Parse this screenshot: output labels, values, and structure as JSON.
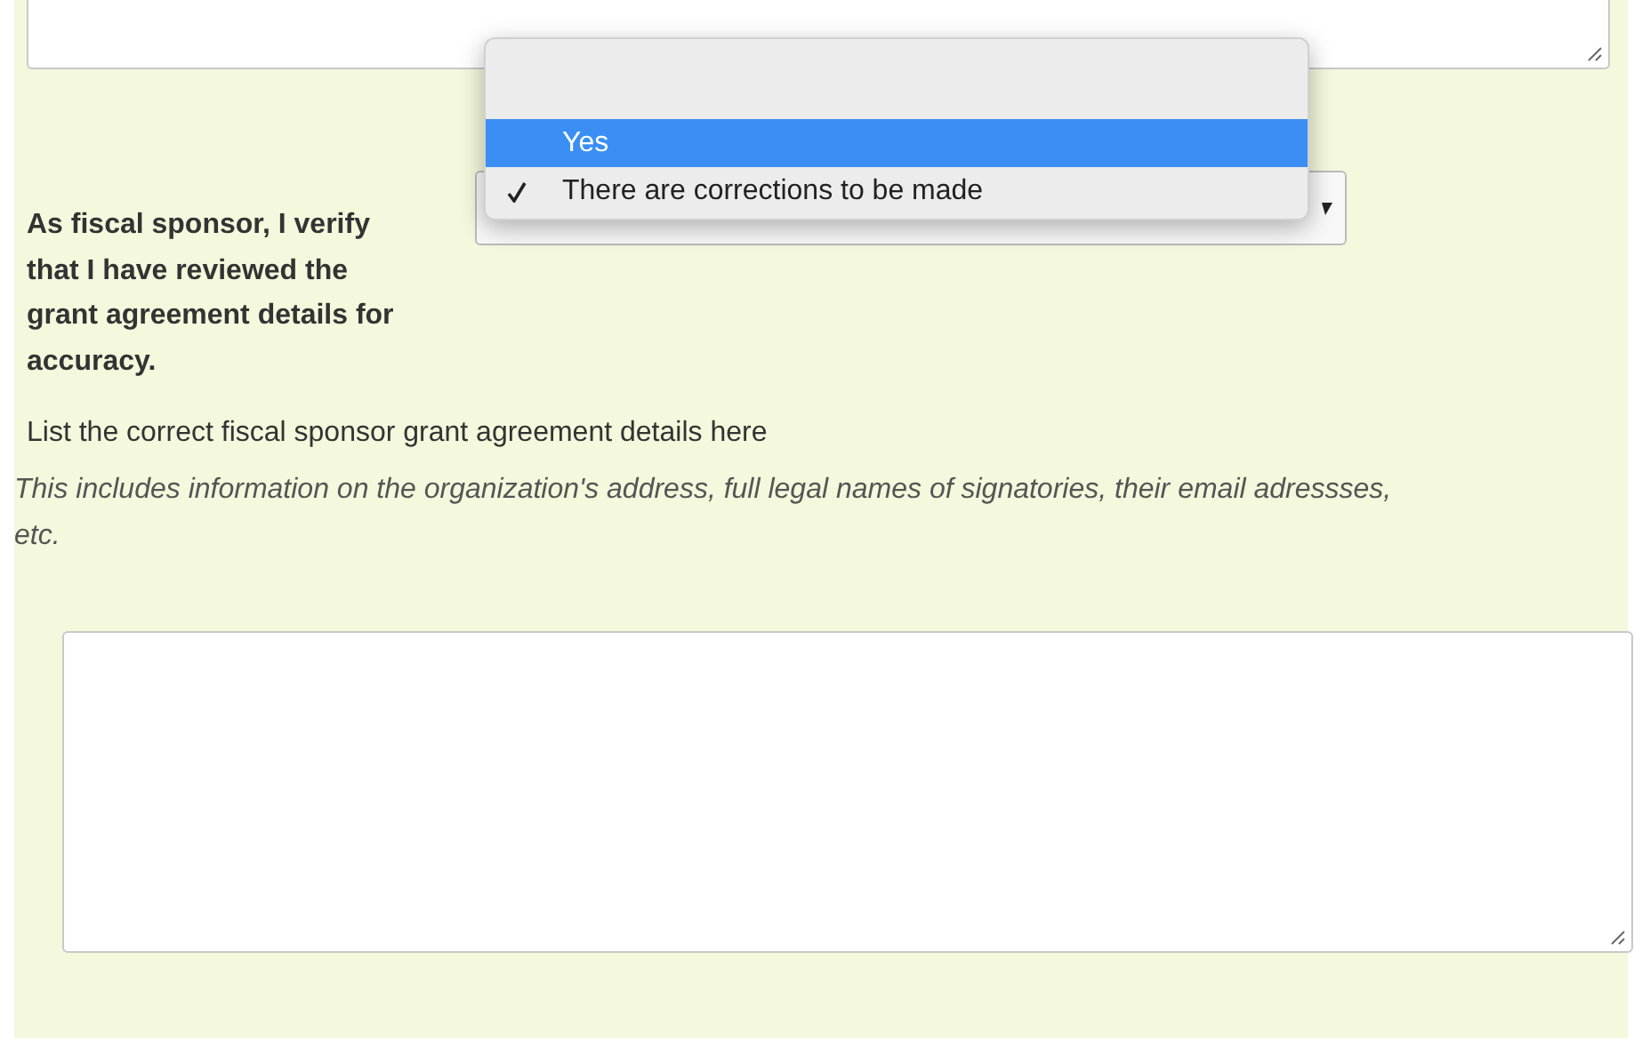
{
  "question": {
    "label": "As fiscal sponsor, I verify that I have reviewed the grant agreement details for accuracy."
  },
  "dropdown_menu": {
    "options": [
      {
        "highlighted": false,
        "checked": false
      },
      {
        "label": "Yes",
        "highlighted": true,
        "checked": false
      },
      {
        "label": "There are corrections to be made",
        "highlighted": false,
        "checked": true
      }
    ]
  },
  "details_field": {
    "label": "List the correct fiscal sponsor grant agreement details here",
    "help": "This includes information on the organization's address, full legal names of signatories, their email adressses, etc."
  }
}
